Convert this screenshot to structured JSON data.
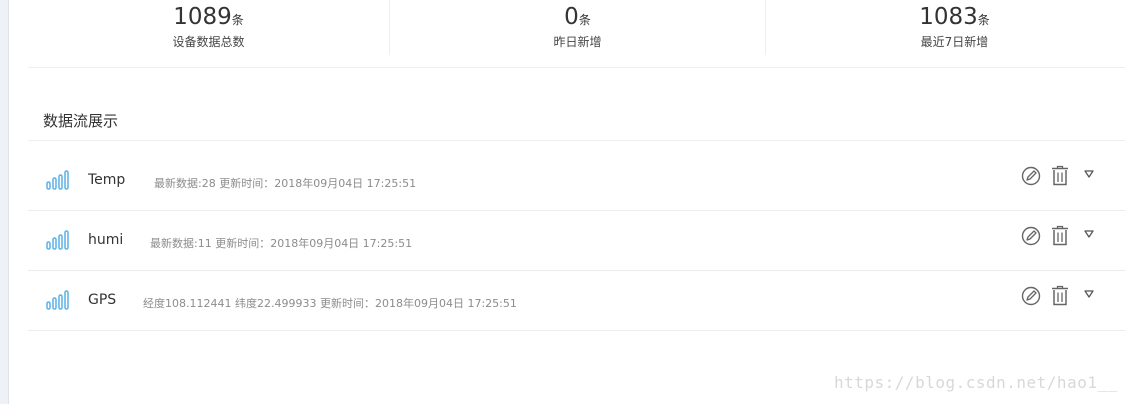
{
  "stats": [
    {
      "value": "1089",
      "unit": "条",
      "label": "设备数据总数"
    },
    {
      "value": "0",
      "unit": "条",
      "label": "昨日新增"
    },
    {
      "value": "1083",
      "unit": "条",
      "label": "最近7日新增"
    }
  ],
  "section": {
    "title": "数据流展示"
  },
  "streams": [
    {
      "name": "Temp",
      "info": "最新数据:28 更新时间：2018年09月04日 17:25:51"
    },
    {
      "name": "humi",
      "info": "最新数据:11 更新时间：2018年09月04日 17:25:51"
    },
    {
      "name": "GPS",
      "info": "经度108.112441 纬度22.499933 更新时间：2018年09月04日 17:25:51"
    }
  ],
  "icons": {
    "stream": "bar-chart-icon",
    "edit": "edit-icon",
    "delete": "trash-icon",
    "expand": "caret-down-icon"
  },
  "colors": {
    "chart_icon": "#5ab1e6",
    "action_icon": "#666666"
  },
  "watermark": "https://blog.csdn.net/hao1__"
}
